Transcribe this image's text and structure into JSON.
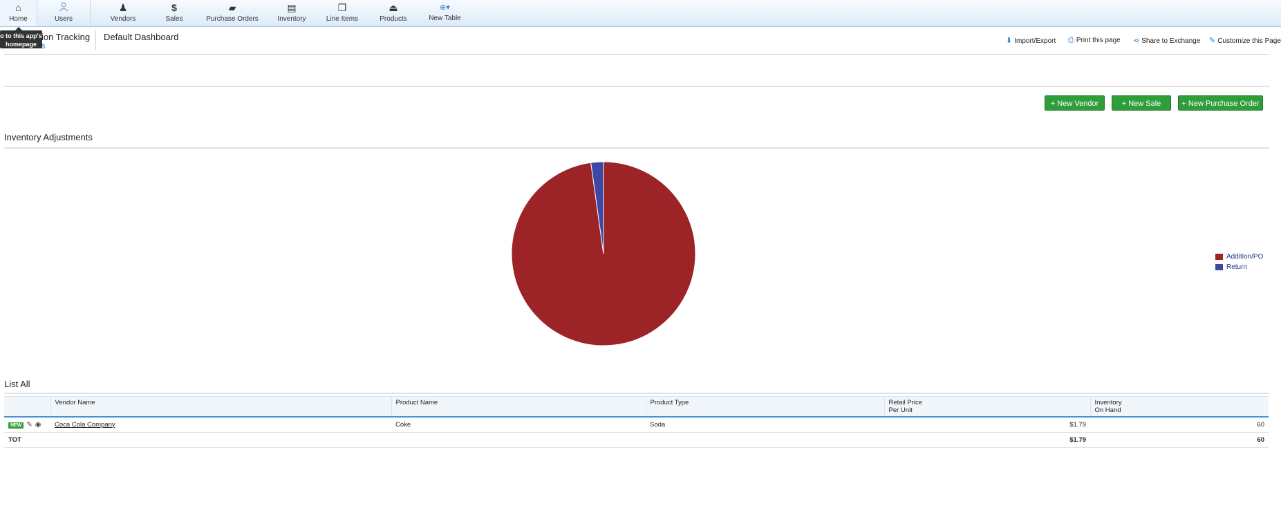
{
  "nav": {
    "items": [
      {
        "label": "Home",
        "icon": "home-icon"
      },
      {
        "label": "Users",
        "icon": "user-icon"
      },
      {
        "label": "Vendors",
        "icon": "vendor-icon"
      },
      {
        "label": "Sales",
        "icon": "dollar-icon"
      },
      {
        "label": "Purchase Orders",
        "icon": "folder-icon"
      },
      {
        "label": "Inventory",
        "icon": "inventory-icon"
      },
      {
        "label": "Line Items",
        "icon": "copy-icon"
      },
      {
        "label": "Products",
        "icon": "bell-icon"
      },
      {
        "label": "New Table",
        "icon": "plus-circle-icon"
      }
    ]
  },
  "tooltip": "o to this app's homepage",
  "breadcrumb": {
    "app": "ion Tracking",
    "sub": "s",
    "page": "Default Dashboard"
  },
  "actions": {
    "import_export": "Import/Export",
    "print": "Print this page",
    "share": "Share to Exchange",
    "customize": "Customize this Page"
  },
  "buttons": {
    "new_vendor": "+ New Vendor",
    "new_sale": "+ New Sale",
    "new_po": "+ New Purchase Order"
  },
  "sections": {
    "inventory_adjustments": "Inventory Adjustments",
    "list_all": "List All"
  },
  "chart_data": {
    "type": "pie",
    "title": "",
    "categories": [
      "Addition/PO",
      "Return"
    ],
    "values": [
      97.8,
      2.2
    ],
    "colors": [
      "#9c2326",
      "#3e47a4"
    ],
    "legend": "right"
  },
  "table": {
    "columns": [
      "",
      "Vendor Name",
      "Product Name",
      "Product Type",
      "Retail Price Per Unit",
      "Inventory On Hand"
    ],
    "col_retail_l1": "Retail Price",
    "col_retail_l2": "Per Unit",
    "col_inv_l1": "Inventory",
    "col_inv_l2": "On Hand",
    "rows": [
      {
        "badge": "NEW",
        "vendor": "Coca Cola Company",
        "product": "Coke",
        "type": "Soda",
        "price": "$1.79",
        "inventory": "60"
      }
    ],
    "totals": {
      "label": "TOT",
      "price": "$1.79",
      "inventory": "60"
    }
  }
}
